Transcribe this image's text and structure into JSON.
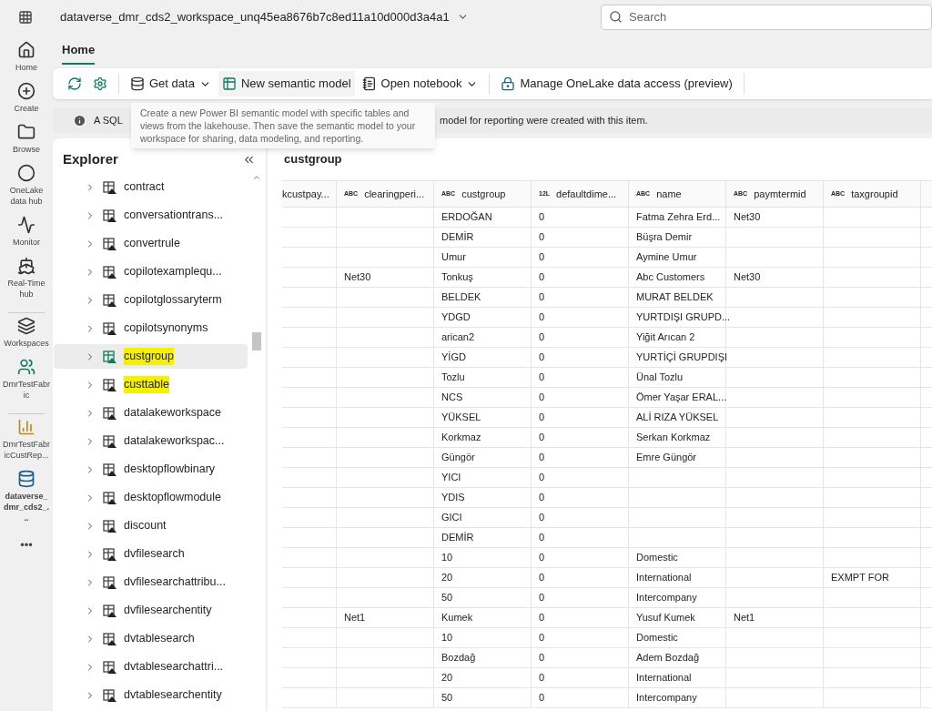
{
  "top_bar": {
    "workspace": "dataverse_dmr_cds2_workspace_unq45ea8676b7c8ed11a10d000d3a4a1",
    "search": {
      "placeholder": "Search"
    }
  },
  "rail": [
    {
      "kind": "home",
      "label": "Home"
    },
    {
      "kind": "create",
      "label": "Create"
    },
    {
      "kind": "browse",
      "label": "Browse"
    },
    {
      "kind": "onelake",
      "label": "OneLake data hub"
    },
    {
      "kind": "monitor",
      "label": "Monitor"
    },
    {
      "kind": "realtime",
      "label": "Real-Time hub"
    },
    {
      "kind": "workspaces",
      "label": "Workspaces"
    },
    {
      "kind": "team",
      "label": "DmrTestFabric"
    },
    {
      "kind": "report",
      "label": "DmrTestFabricCustRep..."
    },
    {
      "kind": "lakehouse",
      "label": "dataverse_dmr_cds2_..."
    },
    {
      "kind": "more",
      "label": "•••"
    }
  ],
  "tabs": [
    {
      "label": "Home",
      "selected": true
    }
  ],
  "toolbar": [
    {
      "kind": "refresh"
    },
    {
      "kind": "settings"
    },
    {
      "kind": "getdata",
      "label": "Get data",
      "dropdown": true
    },
    {
      "kind": "model",
      "label": "New semantic model",
      "dropdown": false
    },
    {
      "kind": "notebook",
      "label": "Open notebook",
      "dropdown": true
    },
    {
      "kind": "access",
      "label": "Manage OneLake data access (preview)",
      "dropdown": false
    }
  ],
  "info_bar": [
    "A SQL",
    "model for reporting were created with this item."
  ],
  "tooltip": "Create a new Power BI semantic model with specific tables and views from the lakehouse. Then save the semantic model to your workspace for sharing, data modeling, and reporting.",
  "explorer": {
    "title": "Explorer",
    "items": [
      {
        "label": "contract",
        "selected": false,
        "highlighted": false
      },
      {
        "label": "conversationtrans...",
        "selected": false,
        "highlighted": false
      },
      {
        "label": "convertrule",
        "selected": false,
        "highlighted": false
      },
      {
        "label": "copilotexamplequ...",
        "selected": false,
        "highlighted": false
      },
      {
        "label": "copilotglossaryterm",
        "selected": false,
        "highlighted": false
      },
      {
        "label": "copilotsynonyms",
        "selected": false,
        "highlighted": false
      },
      {
        "label": "custgroup",
        "selected": true,
        "highlighted": true
      },
      {
        "label": "custtable",
        "selected": false,
        "highlighted": true
      },
      {
        "label": "datalakeworkspace",
        "selected": false,
        "highlighted": false
      },
      {
        "label": "datalakeworkspac...",
        "selected": false,
        "highlighted": false
      },
      {
        "label": "desktopflowbinary",
        "selected": false,
        "highlighted": false
      },
      {
        "label": "desktopflowmodule",
        "selected": false,
        "highlighted": false
      },
      {
        "label": "discount",
        "selected": false,
        "highlighted": false
      },
      {
        "label": "dvfilesearch",
        "selected": false,
        "highlighted": false
      },
      {
        "label": "dvfilesearchattribu...",
        "selected": false,
        "highlighted": false
      },
      {
        "label": "dvfilesearchentity",
        "selected": false,
        "highlighted": false
      },
      {
        "label": "dvtablesearch",
        "selected": false,
        "highlighted": false
      },
      {
        "label": "dvtablesearchattri...",
        "selected": false,
        "highlighted": false
      },
      {
        "label": "dvtablesearchentity",
        "selected": false,
        "highlighted": false
      }
    ]
  },
  "table": {
    "title": "custgroup",
    "columns": [
      {
        "label": "kcustpay..."
      },
      {
        "type": "ABC",
        "label": "clearingperi..."
      },
      {
        "type": "ABC",
        "label": "custgroup"
      },
      {
        "type": "12L",
        "label": "defaultdime..."
      },
      {
        "type": "ABC",
        "label": "name"
      },
      {
        "type": "ABC",
        "label": "paymtermid"
      },
      {
        "type": "ABC",
        "label": "taxgroupid"
      }
    ],
    "rows": [
      [
        null,
        null,
        "ERDOĞAN",
        "0",
        "Fatma Zehra Erd...",
        "Net30",
        null
      ],
      [
        null,
        null,
        "DEMİR",
        "0",
        "Büşra Demir",
        null,
        null
      ],
      [
        null,
        null,
        "Umur",
        "0",
        "Aymine Umur",
        null,
        null
      ],
      [
        null,
        "Net30",
        "Tonkuş",
        "0",
        "Abc Customers",
        "Net30",
        null
      ],
      [
        null,
        null,
        "BELDEK",
        "0",
        "MURAT BELDEK",
        null,
        null
      ],
      [
        null,
        null,
        "YDGD",
        "0",
        "YURTDIŞI GRUPD...",
        null,
        null
      ],
      [
        null,
        null,
        "arican2",
        "0",
        "Yiğit Arıcan 2",
        null,
        null
      ],
      [
        null,
        null,
        "YİGD",
        "0",
        "YURTİÇİ GRUPDIŞI",
        null,
        null
      ],
      [
        null,
        null,
        "Tozlu",
        "0",
        "Ünal Tozlu",
        null,
        null
      ],
      [
        null,
        null,
        "NCS",
        "0",
        "Ömer Yaşar ERAL...",
        null,
        null
      ],
      [
        null,
        null,
        "YÜKSEL",
        "0",
        "ALİ RIZA YÜKSEL",
        null,
        null
      ],
      [
        null,
        null,
        "Korkmaz",
        "0",
        "Serkan Korkmaz",
        null,
        null
      ],
      [
        null,
        null,
        "Güngör",
        "0",
        "Emre Güngör",
        null,
        null
      ],
      [
        null,
        null,
        "YICI",
        "0",
        null,
        null,
        null
      ],
      [
        null,
        null,
        "YDIS",
        "0",
        null,
        null,
        null
      ],
      [
        null,
        null,
        "GICI",
        "0",
        null,
        null,
        null
      ],
      [
        null,
        null,
        "DEMİR",
        "0",
        null,
        null,
        null
      ],
      [
        null,
        null,
        "10",
        "0",
        "Domestic",
        null,
        null
      ],
      [
        null,
        null,
        "20",
        "0",
        "International",
        null,
        "EXMPT FOR"
      ],
      [
        null,
        null,
        "50",
        "0",
        "Intercompany",
        null,
        null
      ],
      [
        null,
        "Net1",
        "Kumek",
        "0",
        "Yusuf Kumek",
        "Net1",
        null
      ],
      [
        null,
        null,
        "10",
        "0",
        "Domestic",
        null,
        null
      ],
      [
        null,
        null,
        "Bozdağ",
        "0",
        "Adem Bozdağ",
        null,
        null
      ],
      [
        null,
        null,
        "20",
        "0",
        "International",
        null,
        null
      ],
      [
        null,
        null,
        "50",
        "0",
        "Intercompany",
        null,
        null
      ]
    ]
  }
}
